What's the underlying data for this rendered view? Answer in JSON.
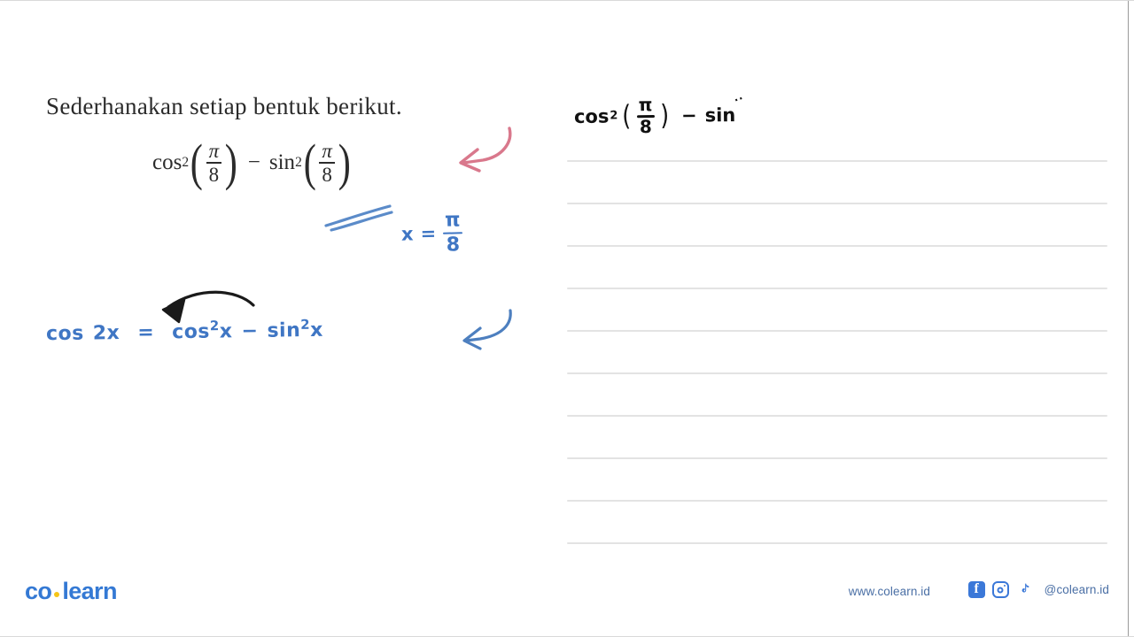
{
  "document": {
    "type": "math-worksheet",
    "language": "id"
  },
  "question": {
    "instruction": "Sederhanakan setiap bentuk berikut.",
    "expression": {
      "term1": {
        "fn": "cos",
        "power": "2",
        "arg_num": "π",
        "arg_den": "8"
      },
      "operator": "−",
      "term2": {
        "fn": "sin",
        "power": "2",
        "arg_num": "π",
        "arg_den": "8"
      },
      "plain": "cos² (π/8) − sin² (π/8)"
    }
  },
  "annotations": {
    "substitution": {
      "variable": "x",
      "equals": "=",
      "value_num": "π",
      "value_den": "8",
      "plain": "x = π/8",
      "color": "#3f76c4"
    },
    "identity": {
      "lhs_fn": "cos",
      "lhs_arg": "2x",
      "equals": "=",
      "rhs_fn1": "cos",
      "rhs_pow1": "2",
      "rhs_var1": "x",
      "rhs_op": "−",
      "rhs_fn2": "sin",
      "rhs_pow2": "2",
      "rhs_var2": "x",
      "plain": "cos 2x = cos²x − sin²x",
      "color": "#3f76c4"
    },
    "marks": [
      {
        "name": "pink-curved-arrow",
        "color": "#d9788c",
        "points_to": "question-expression"
      },
      {
        "name": "blue-underline-double",
        "color": "#5b8bc9",
        "points_to": "substitution"
      },
      {
        "name": "black-curved-arrow",
        "color": "#1a1a1a",
        "points_to": "identity"
      },
      {
        "name": "blue-curved-arrow",
        "color": "#4d7fbf",
        "points_to": "identity"
      }
    ]
  },
  "answer_sheet": {
    "rule_count": 10,
    "rule_color": "#e3e3e3",
    "handwriting": {
      "fn1": "cos",
      "pow1": "2",
      "paren_open": "(",
      "num": "π",
      "den": "8",
      "paren_close": ")",
      "operator": "−",
      "fn2": "sin",
      "dots": "··",
      "plain": "cos² (π/8) − sin",
      "color": "#111111"
    }
  },
  "footer": {
    "logo": {
      "part1": "co",
      "part2": "learn",
      "dot_color": "#f5c518",
      "text_color": "#3479d4"
    },
    "website": "www.colearn.id",
    "handle": "@colearn.id",
    "socials": [
      {
        "name": "facebook-icon",
        "glyph": "f"
      },
      {
        "name": "instagram-icon",
        "glyph": ""
      },
      {
        "name": "tiktok-icon",
        "glyph": "♪"
      }
    ]
  }
}
